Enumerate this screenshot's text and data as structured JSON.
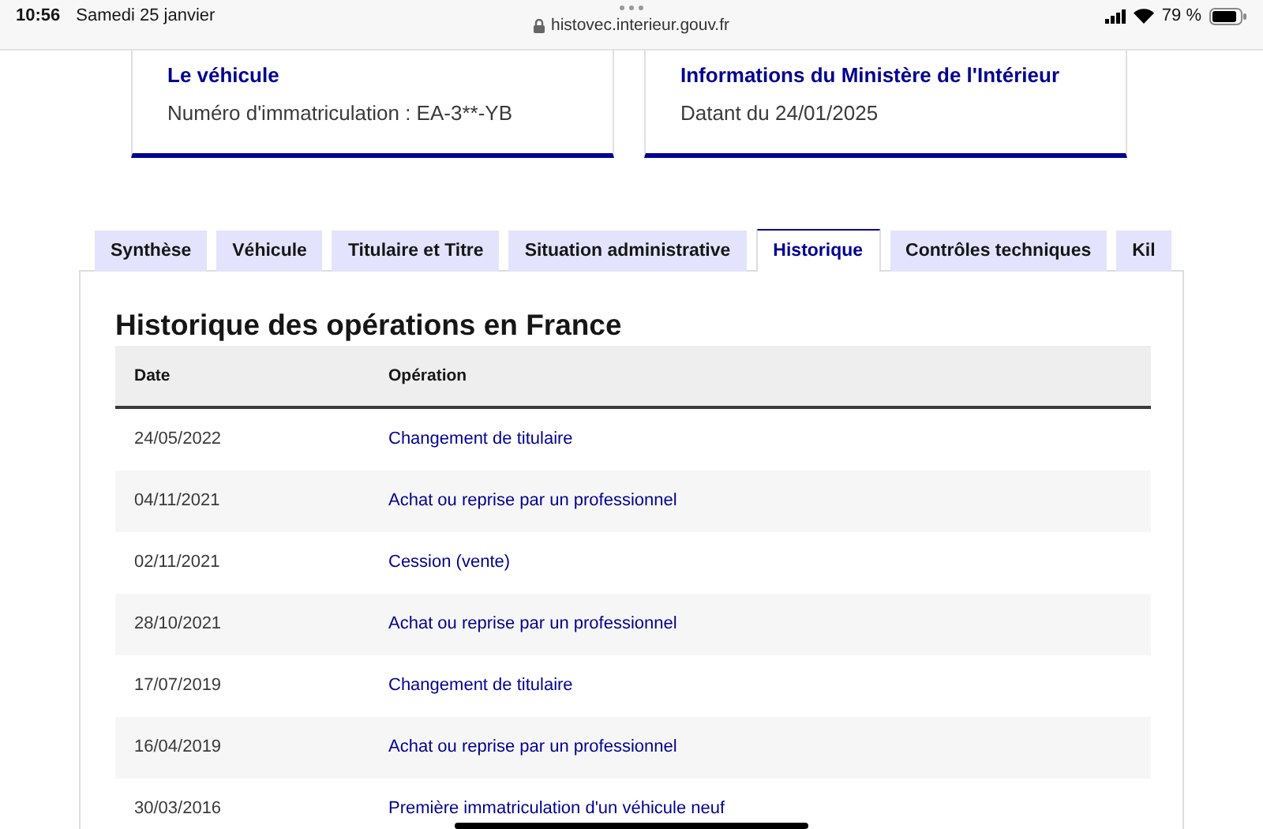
{
  "status_bar": {
    "time": "10:56",
    "date": "Samedi 25 janvier",
    "url": "histovec.interieur.gouv.fr",
    "battery": "79 %"
  },
  "cards": [
    {
      "title": "Le véhicule",
      "text": "Numéro d'immatriculation : EA-3**-YB"
    },
    {
      "title": "Informations du Ministère de l'Intérieur",
      "text": "Datant du 24/01/2025"
    }
  ],
  "tabs": [
    {
      "label": "Synthèse",
      "selected": false
    },
    {
      "label": "Véhicule",
      "selected": false
    },
    {
      "label": "Titulaire et Titre",
      "selected": false
    },
    {
      "label": "Situation administrative",
      "selected": false
    },
    {
      "label": "Historique",
      "selected": true
    },
    {
      "label": "Contrôles techniques",
      "selected": false
    },
    {
      "label": "Kil",
      "selected": false
    }
  ],
  "panel": {
    "title": "Historique des opérations en France",
    "table": {
      "columns": [
        "Date",
        "Opération"
      ],
      "rows": [
        [
          "24/05/2022",
          "Changement de titulaire"
        ],
        [
          "04/11/2021",
          "Achat ou reprise par un professionnel"
        ],
        [
          "02/11/2021",
          "Cession (vente)"
        ],
        [
          "28/10/2021",
          "Achat ou reprise par un professionnel"
        ],
        [
          "17/07/2019",
          "Changement de titulaire"
        ],
        [
          "16/04/2019",
          "Achat ou reprise par un professionnel"
        ],
        [
          "30/03/2016",
          "Première immatriculation d'un véhicule neuf"
        ]
      ]
    }
  }
}
